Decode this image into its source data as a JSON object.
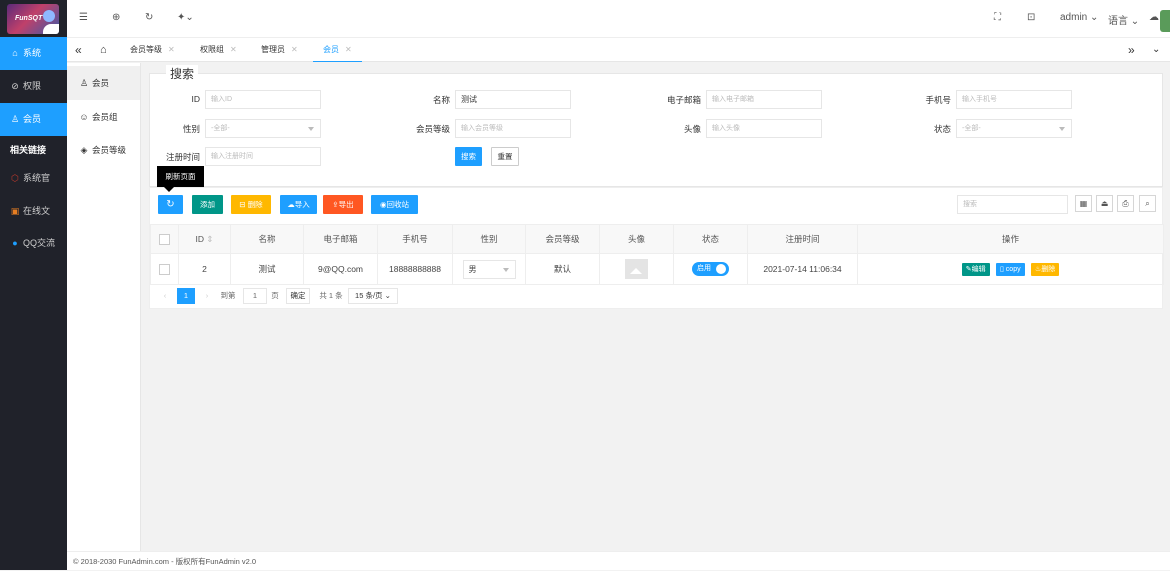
{
  "sidebar": {
    "logo_text": "FunSQT",
    "items": [
      {
        "label": "系统",
        "icon": "home-icon",
        "active": true
      },
      {
        "label": "权限",
        "icon": "shield-icon",
        "active": false
      },
      {
        "label": "会员",
        "icon": "user-icon",
        "active": true
      },
      {
        "label": "相关链接",
        "icon": "",
        "active": false
      },
      {
        "label": "系统官",
        "icon": "hexagon-icon",
        "active": false
      },
      {
        "label": "在线文",
        "icon": "doc-icon",
        "active": false
      },
      {
        "label": "QQ交流",
        "icon": "qq-icon",
        "active": false
      }
    ]
  },
  "topbar": {
    "user": "admin",
    "language": "语言"
  },
  "tabs": [
    {
      "label": "会员等级"
    },
    {
      "label": "权限组"
    },
    {
      "label": "管理员"
    },
    {
      "label": "会员"
    }
  ],
  "submenu": [
    {
      "label": "会员"
    },
    {
      "label": "会员组"
    },
    {
      "label": "会员等级"
    }
  ],
  "search": {
    "legend": "搜索",
    "fields": {
      "id": {
        "label": "ID",
        "placeholder": "输入ID",
        "value": ""
      },
      "name": {
        "label": "名称",
        "placeholder": "",
        "value": "测试"
      },
      "email": {
        "label": "电子邮箱",
        "placeholder": "输入电子邮箱",
        "value": ""
      },
      "mobile": {
        "label": "手机号",
        "placeholder": "输入手机号",
        "value": ""
      },
      "sex": {
        "label": "性别",
        "placeholder": "-全部-",
        "value": ""
      },
      "level": {
        "label": "会员等级",
        "placeholder": "输入会员等级",
        "value": ""
      },
      "avatar": {
        "label": "头像",
        "placeholder": "输入头像",
        "value": ""
      },
      "status": {
        "label": "状态",
        "placeholder": "-全部-",
        "value": ""
      },
      "create_time": {
        "label": "注册时间",
        "placeholder": "输入注册时间",
        "value": ""
      }
    },
    "search_btn": "搜索",
    "reset_btn": "重置"
  },
  "toolbar": {
    "tooltip": "刷新页面",
    "add": "添加",
    "delete": "删除",
    "import": "导入",
    "export": "导出",
    "recycle": "回收站",
    "search_placeholder": "搜索"
  },
  "table": {
    "columns": [
      "ID",
      "名称",
      "电子邮箱",
      "手机号",
      "性别",
      "会员等级",
      "头像",
      "状态",
      "注册时间",
      "操作"
    ],
    "rows": [
      {
        "id": "2",
        "name": "测试",
        "email": "9@QQ.com",
        "mobile": "18888888888",
        "sex": "男",
        "level": "默认",
        "status": "启用",
        "time": "2021-07-14 11:06:34",
        "actions": {
          "edit": "编辑",
          "copy": "copy",
          "delete": "删除"
        }
      }
    ]
  },
  "pager": {
    "current": "1",
    "goto": "到第",
    "page_value": "1",
    "page_unit": "页",
    "confirm": "确定",
    "total": "共 1 条",
    "per_page": "15 条/页"
  },
  "footer": "© 2018-2030 FunAdmin.com - 版权所有FunAdmin v2.0",
  "colors": {
    "primary": "#1e9fff",
    "green": "#009688",
    "orange": "#ffb800",
    "red": "#ff5722",
    "sidebar": "#20222a"
  }
}
